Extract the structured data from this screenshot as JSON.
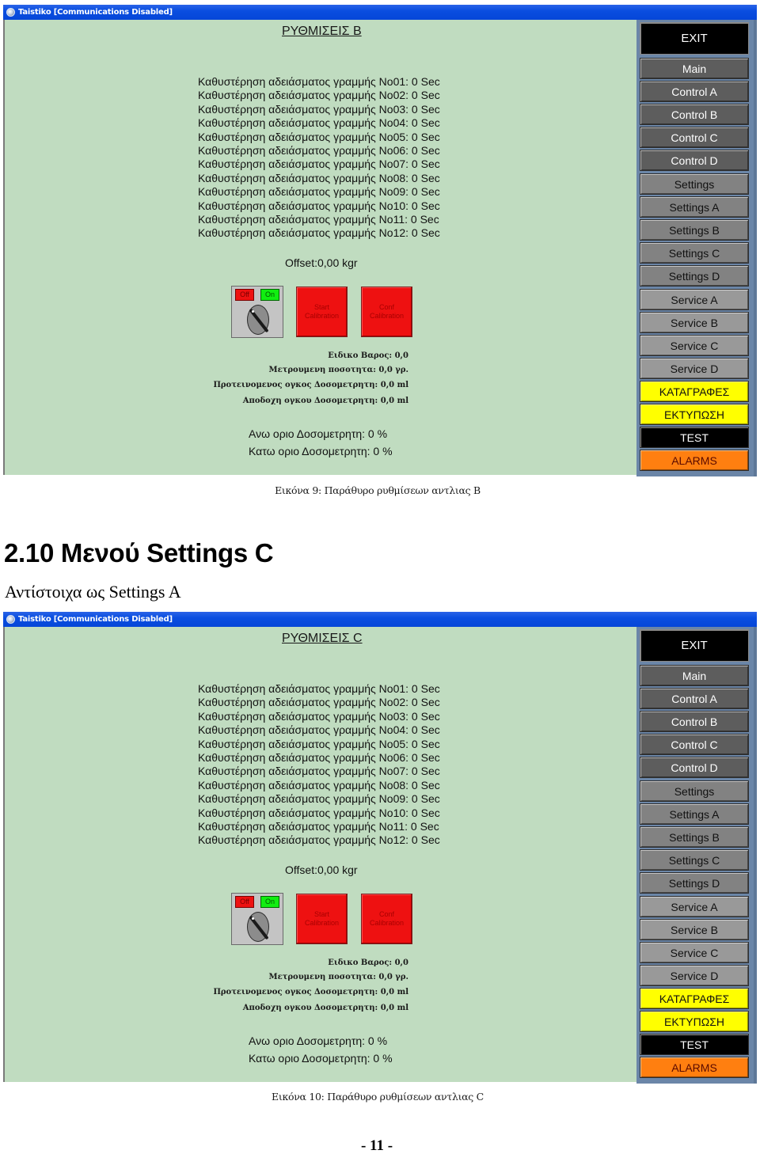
{
  "windows": [
    {
      "title_bar": "Taistiko [Communications Disabled]",
      "screen_title": "ΡΥΘΜΙΣΕΙΣ B",
      "delay_rows": [
        "Καθυστέρηση αδειάσματος γραμμής No01: 0 Sec",
        "Καθυστέρηση αδειάσματος γραμμής No02: 0 Sec",
        "Καθυστέρηση αδειάσματος γραμμής No03: 0 Sec",
        "Καθυστέρηση αδειάσματος γραμμής No04: 0 Sec",
        "Καθυστέρηση αδειάσματος γραμμής No05: 0 Sec",
        "Καθυστέρηση αδειάσματος γραμμής No06: 0 Sec",
        "Καθυστέρηση αδειάσματος γραμμής No07: 0 Sec",
        "Καθυστέρηση αδειάσματος γραμμής No08: 0 Sec",
        "Καθυστέρηση αδειάσματος γραμμής No09: 0 Sec",
        "Καθυστέρηση αδειάσματος γραμμής No10: 0 Sec",
        "Καθυστέρηση αδειάσματος γραμμής No11: 0 Sec",
        "Καθυστέρηση αδειάσματος γραμμής No12: 0 Sec"
      ],
      "offset": "Offset:0,00 kgr",
      "switch": {
        "off_label": "Off",
        "on_label": "On"
      },
      "start_calibration": "Start Calibration",
      "conf_calibration": "Conf Calibration",
      "readings": [
        "Ειδικο Βαρος: 0,0",
        "Μετρουμενη ποσοτητα: 0,0 γρ.",
        "Προτεινομενος ογκος Δοσομετρητη: 0,0 ml",
        "Αποδοχη ογκου Δοσομετρητη: 0,0 ml"
      ],
      "upper_limit": "Ανω οριο Δοσομετρητη: 0 %",
      "lower_limit": "Κατω οριο Δοσομετρητη: 0 %"
    },
    {
      "title_bar": "Taistiko [Communications Disabled]",
      "screen_title": "ΡΥΘΜΙΣΕΙΣ C",
      "delay_rows": [
        "Καθυστέρηση αδειάσματος γραμμής No01: 0 Sec",
        "Καθυστέρηση αδειάσματος γραμμής No02: 0 Sec",
        "Καθυστέρηση αδειάσματος γραμμής No03: 0 Sec",
        "Καθυστέρηση αδειάσματος γραμμής No04: 0 Sec",
        "Καθυστέρηση αδειάσματος γραμμής No05: 0 Sec",
        "Καθυστέρηση αδειάσματος γραμμής No06: 0 Sec",
        "Καθυστέρηση αδειάσματος γραμμής No07: 0 Sec",
        "Καθυστέρηση αδειάσματος γραμμής No08: 0 Sec",
        "Καθυστέρηση αδειάσματος γραμμής No09: 0 Sec",
        "Καθυστέρηση αδειάσματος γραμμής No10: 0 Sec",
        "Καθυστέρηση αδειάσματος γραμμής No11: 0 Sec",
        "Καθυστέρηση αδειάσματος γραμμής No12: 0 Sec"
      ],
      "offset": "Offset:0,00 kgr",
      "switch": {
        "off_label": "Off",
        "on_label": "On"
      },
      "start_calibration": "Start Calibration",
      "conf_calibration": "Conf Calibration",
      "readings": [
        "Ειδικο Βαρος: 0,0",
        "Μετρουμενη ποσοτητα: 0,0 γρ.",
        "Προτεινομενος ογκος Δοσομετρητη: 0,0 ml",
        "Αποδοχη ογκου Δοσομετρητη: 0,0 ml"
      ],
      "upper_limit": "Ανω οριο Δοσομετρητη: 0 %",
      "lower_limit": "Κατω οριο Δοσομετρητη: 0 %"
    }
  ],
  "nav": {
    "exit": "EXIT",
    "main": "Main",
    "control_a": "Control A",
    "control_b": "Control B",
    "control_c": "Control C",
    "control_d": "Control D",
    "settings": "Settings",
    "settings_a": "Settings A",
    "settings_b": "Settings B",
    "settings_c": "Settings C",
    "settings_d": "Settings D",
    "service_a": "Service A",
    "service_b": "Service B",
    "service_c": "Service C",
    "service_d": "Service D",
    "records": "ΚΑΤΑΓΡΑΦΕΣ",
    "print": "ΕΚΤΥΠΩΣΗ",
    "test": "TEST",
    "alarms": "ALARMS"
  },
  "colors": {
    "client_bg": "#c0dcc0",
    "titlebar": "#0a4ee0",
    "nav_panel": "#6b86a8",
    "alarm": "#ff7f10",
    "highlight": "#ffff00",
    "calibration_red": "#ee1111"
  },
  "document": {
    "caption_9": "Εικόνα 9: Παράθυρο ρυθμίσεων αντλιας B",
    "section_heading": "2.10 Μενού Settings C",
    "section_text": "Αντίστοιχα ως Settings A",
    "caption_10": "Εικόνα 10: Παράθυρο ρυθμίσεων αντλιας C",
    "page_number": "- 11 -"
  }
}
